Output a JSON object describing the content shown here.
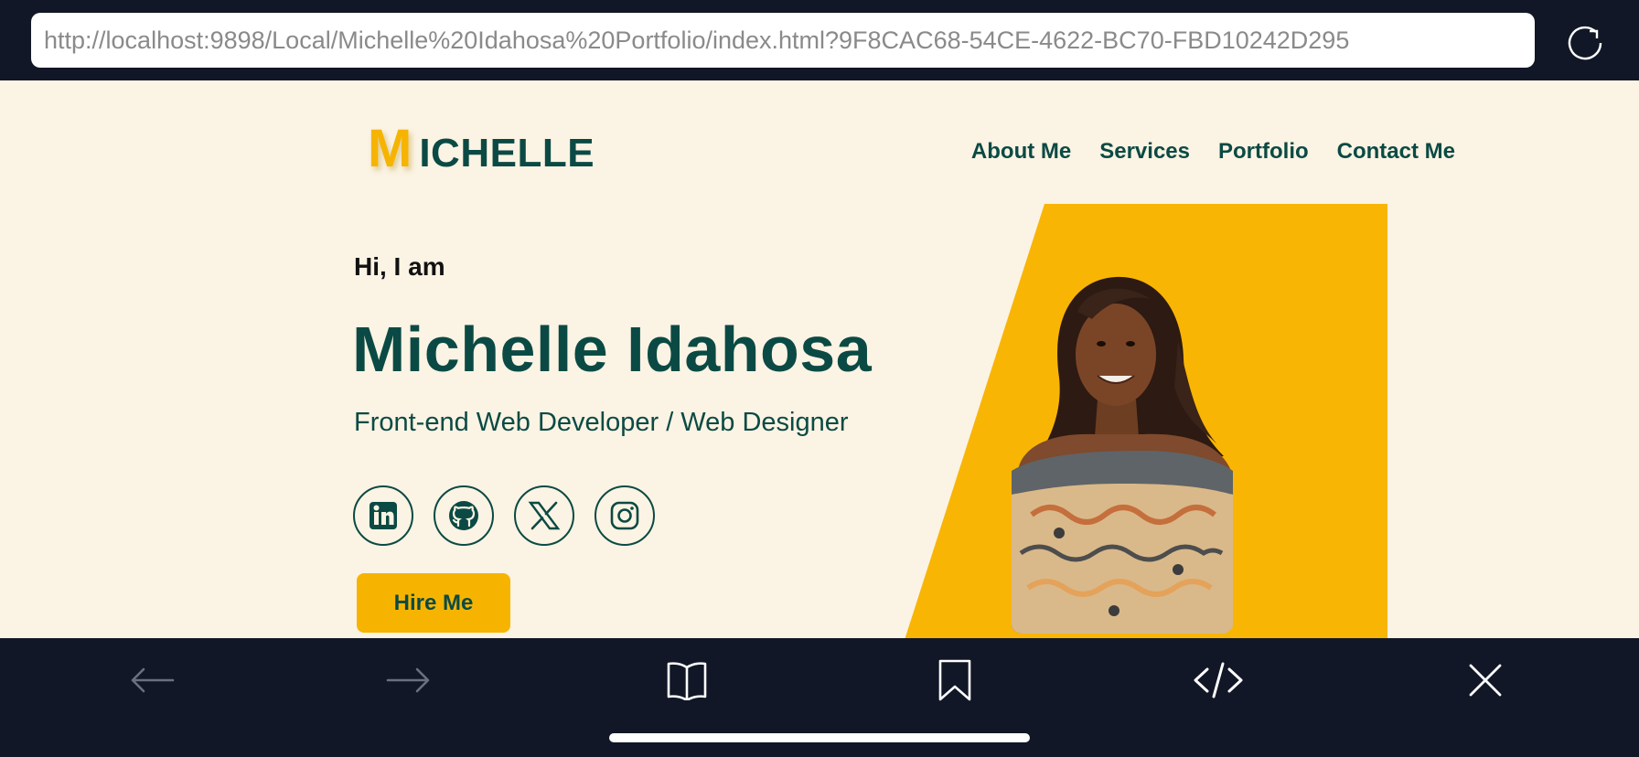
{
  "browser": {
    "url": "http://localhost:9898/Local/Michelle%20Idahosa%20Portfolio/index.html?9F8CAC68-54CE-4622-BC70-FBD10242D295",
    "reload_icon": "reload-icon",
    "toolbar_icons": [
      "back-arrow-icon",
      "forward-arrow-icon",
      "book-icon",
      "bookmark-icon",
      "code-icon",
      "close-icon"
    ]
  },
  "header": {
    "logo_initial": "M",
    "logo_rest": "ICHELLE",
    "nav": [
      "About Me",
      "Services",
      "Portfolio",
      "Contact Me"
    ]
  },
  "hero": {
    "greeting": "Hi, I am",
    "name": "Michelle Idahosa",
    "role": "Front-end Web Developer / Web Designer",
    "socials": [
      "linkedin-icon",
      "github-icon",
      "x-icon",
      "instagram-icon"
    ],
    "cta": "Hire Me"
  },
  "colors": {
    "brand_green": "#0b4a44",
    "accent_yellow": "#f6b400",
    "page_bg": "#fbf3e3",
    "chrome_bg": "#111726"
  }
}
